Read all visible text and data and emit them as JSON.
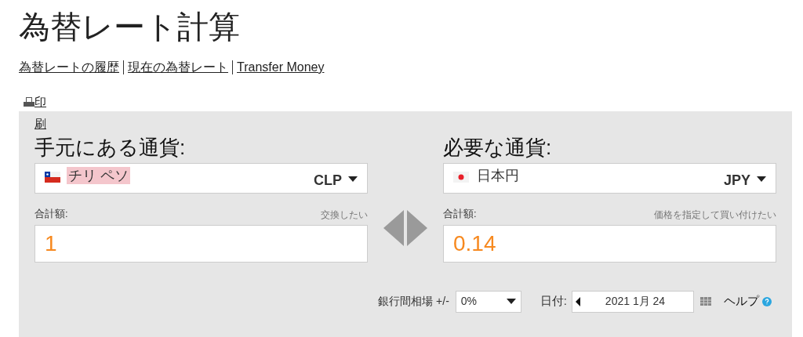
{
  "title": "為替レート計算",
  "links": [
    {
      "label": "為替レートの履歴"
    },
    {
      "label": "現在の為替レート"
    },
    {
      "label": "Transfer Money"
    }
  ],
  "print": {
    "label": "印刷"
  },
  "panels": [
    {
      "heading": "手元にある通貨:",
      "kind": "cl",
      "currency_name": "チリ ペソ",
      "highlighted": true,
      "code": "CLP",
      "amount_label": "合計額:",
      "hint": "交換したい",
      "amount": "1"
    },
    {
      "heading": "必要な通貨:",
      "kind": "jp",
      "currency_name": "日本円",
      "highlighted": false,
      "code": "JPY",
      "amount_label": "合計額:",
      "hint": "価格を指定して買い付けたい",
      "amount": "0.14"
    }
  ],
  "interbank": {
    "label": "銀行間相場 +/-",
    "value": "0%"
  },
  "date": {
    "label": "日付:",
    "value": "2021 1月 24"
  },
  "help": {
    "label": "ヘルプ"
  }
}
